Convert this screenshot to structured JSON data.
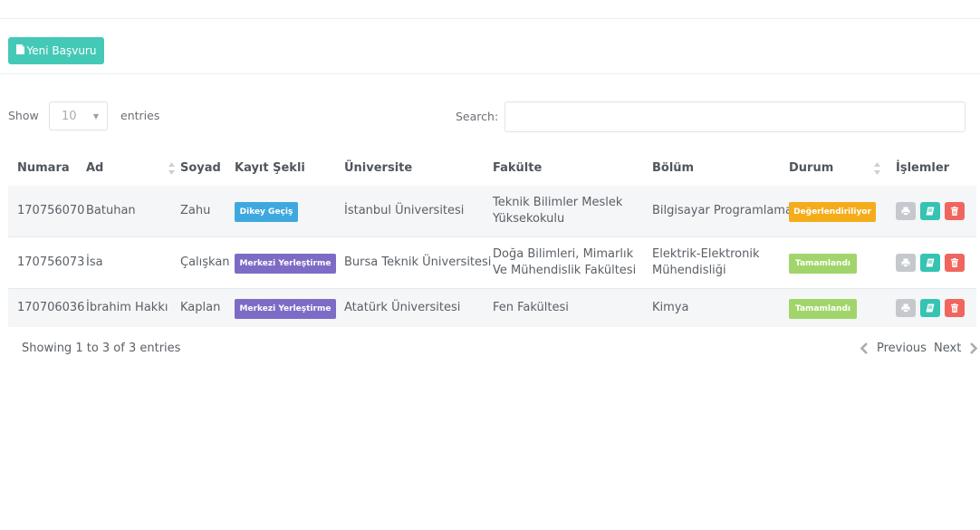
{
  "toolbar": {
    "new_button_label": "Yeni Başvuru",
    "new_button_icon": "file-icon"
  },
  "table_controls": {
    "show_label": "Show",
    "page_length_value": "10",
    "entries_label": "entries",
    "search_label": "Search:",
    "search_value": ""
  },
  "columns": [
    "Numara",
    "Ad",
    "Soyad",
    "Kayıt Şekli",
    "Üniversite",
    "Fakülte",
    "Bölüm",
    "Durum",
    "İşlemler"
  ],
  "rows": [
    {
      "numara": "170756070",
      "ad": "Batuhan",
      "soyad": "Zahu",
      "kayit_sekli": "Dikey Geçiş",
      "universite": "İstanbul Üniversitesi",
      "fakulte": "Teknik Bilimler Meslek Yüksekokulu",
      "bolum": "Bilgisayar Programlama",
      "durum": "Değerlendiriliyor"
    },
    {
      "numara": "170756073",
      "ad": "İsa",
      "soyad": "Çalışkan",
      "kayit_sekli": "Merkezi Yerleştirme",
      "universite": "Bursa Teknik Üniversitesi",
      "fakulte": "Doğa Bilimleri, Mimarlık Ve Mühendislik Fakültesi",
      "bolum": "Elektrik-Elektronik Mühendisliği",
      "durum": "Tamamlandı"
    },
    {
      "numara": "170706036",
      "ad": "İbrahim Hakkı",
      "soyad": "Kaplan",
      "kayit_sekli": "Merkezi Yerleştirme",
      "universite": "Atatürk Üniversitesi",
      "fakulte": "Fen Fakültesi",
      "bolum": "Kimya",
      "durum": "Tamamlandı"
    }
  ],
  "footer": {
    "info": "Showing 1 to 3 of 3 entries",
    "previous": "Previous",
    "next": "Next"
  },
  "colors": {
    "primary_button": "#45c9b7",
    "badge_dikey": "#3fa9df",
    "badge_merkezi": "#7e6bc5",
    "status_pending": "#f5ac1b",
    "status_done": "#a1d56b",
    "action_print": "#c5c9cd",
    "action_book": "#35c3b2",
    "action_delete": "#f0665f"
  }
}
